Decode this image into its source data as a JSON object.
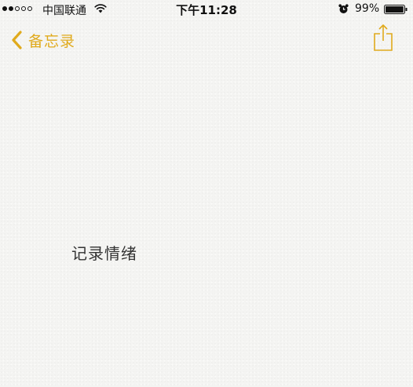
{
  "status_bar": {
    "signal_bars_filled": 2,
    "signal_bars_total": 5,
    "carrier": "中国联通",
    "wifi_icon": "wifi-icon",
    "time": "下午11:28",
    "alarm_icon": "alarm-clock-icon",
    "battery_percent_text": "99%",
    "battery_level": 0.99
  },
  "nav": {
    "back_label": "备忘录",
    "back_icon": "chevron-left-icon",
    "share_icon": "share-icon",
    "accent_color": "#e0aa1c"
  },
  "note": {
    "content": "记录情绪"
  }
}
